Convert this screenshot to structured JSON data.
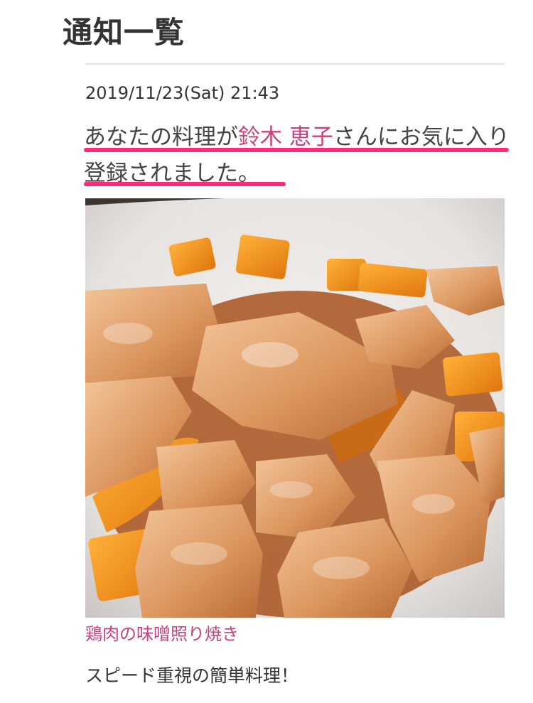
{
  "header": {
    "title": "通知一覧"
  },
  "notification": {
    "date": "2019/11/23(Sat) 21:43",
    "message_prefix": "あなたの料理が",
    "user_name": "鈴木 恵子",
    "message_suffix": "さんにお気に入り登録されました。"
  },
  "recipe": {
    "image_icon": "food-photo",
    "title": "鶏肉の味噌照り焼き",
    "description": "スピード重視の簡単料理！"
  },
  "colors": {
    "accent": "#c8417f",
    "highlight": "#ff2a78",
    "text": "#333333"
  }
}
